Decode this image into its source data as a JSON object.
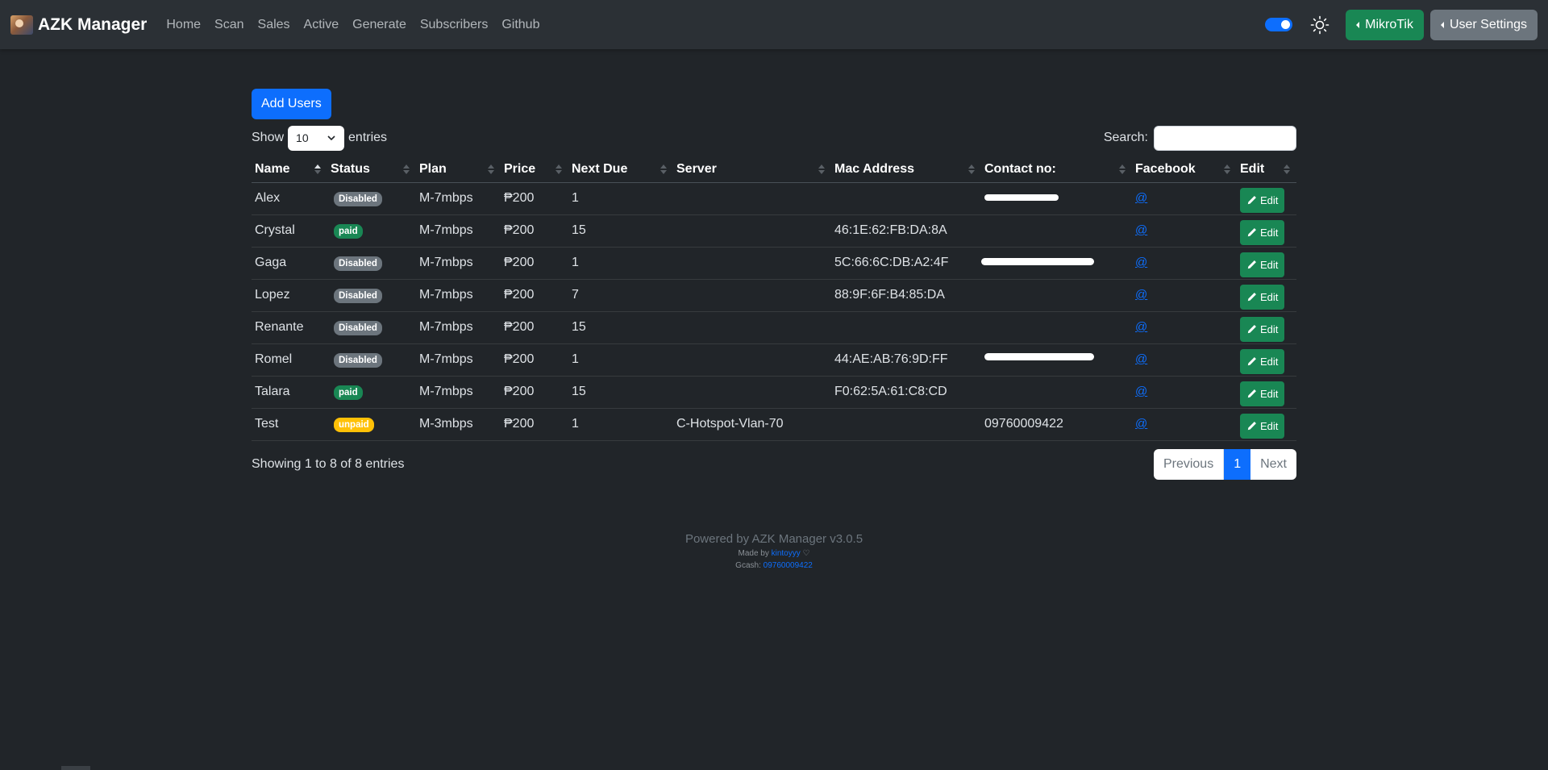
{
  "app": {
    "brand": "AZK Manager",
    "nav": [
      "Home",
      "Scan",
      "Sales",
      "Active",
      "Generate",
      "Subscribers",
      "Github"
    ],
    "mikrotik_label": "MikroTik",
    "user_settings_label": "User Settings"
  },
  "toolbar": {
    "add_users_label": "Add Users",
    "show_label": "Show",
    "entries_label": "entries",
    "entries_value": "10",
    "search_label": "Search:",
    "search_value": ""
  },
  "table": {
    "columns": [
      "Name",
      "Status",
      "Plan",
      "Price",
      "Next Due",
      "Server",
      "Mac Address",
      "Contact no:",
      "Facebook",
      "Edit"
    ],
    "rows": [
      {
        "name": "Alex",
        "status": "Disabled",
        "plan": "M-7mbps",
        "price": "₱200",
        "next_due": "1",
        "server": "",
        "mac": "",
        "contact": "",
        "facebook": "@",
        "edit": "Edit"
      },
      {
        "name": "Crystal",
        "status": "paid",
        "plan": "M-7mbps",
        "price": "₱200",
        "next_due": "15",
        "server": "",
        "mac": "46:1E:62:FB:DA:8A",
        "contact": "",
        "facebook": "@",
        "edit": "Edit"
      },
      {
        "name": "Gaga",
        "status": "Disabled",
        "plan": "M-7mbps",
        "price": "₱200",
        "next_due": "1",
        "server": "",
        "mac": "5C:66:6C:DB:A2:4F",
        "contact": "",
        "facebook": "@",
        "edit": "Edit"
      },
      {
        "name": "Lopez",
        "status": "Disabled",
        "plan": "M-7mbps",
        "price": "₱200",
        "next_due": "7",
        "server": "",
        "mac": "88:9F:6F:B4:85:DA",
        "contact": "",
        "facebook": "@",
        "edit": "Edit"
      },
      {
        "name": "Renante",
        "status": "Disabled",
        "plan": "M-7mbps",
        "price": "₱200",
        "next_due": "15",
        "server": "",
        "mac": "",
        "contact": "",
        "facebook": "@",
        "edit": "Edit"
      },
      {
        "name": "Romel",
        "status": "Disabled",
        "plan": "M-7mbps",
        "price": "₱200",
        "next_due": "1",
        "server": "",
        "mac": "44:AE:AB:76:9D:FF",
        "contact": "",
        "facebook": "@",
        "edit": "Edit"
      },
      {
        "name": "Talara",
        "status": "paid",
        "plan": "M-7mbps",
        "price": "₱200",
        "next_due": "15",
        "server": "",
        "mac": "F0:62:5A:61:C8:CD",
        "contact": "",
        "facebook": "@",
        "edit": "Edit"
      },
      {
        "name": "Test",
        "status": "unpaid",
        "plan": "M-3mbps",
        "price": "₱200",
        "next_due": "1",
        "server": "C-Hotspot-Vlan-70",
        "mac": "",
        "contact": "09760009422",
        "facebook": "@",
        "edit": "Edit"
      }
    ]
  },
  "pagination": {
    "info": "Showing 1 to 8 of 8 entries",
    "previous": "Previous",
    "current": "1",
    "next": "Next"
  },
  "footer": {
    "powered": "Powered by AZK Manager v3.0.5",
    "made_by_label": "Made by",
    "made_by_name": "kintoyyy",
    "gcash_label": "Gcash:",
    "gcash_number": "09760009422"
  },
  "colors": {
    "background": "#212529",
    "navbar": "#2b3035",
    "primary": "#0d6efd",
    "success": "#198754",
    "secondary": "#6c757d",
    "warning": "#ffc107"
  }
}
